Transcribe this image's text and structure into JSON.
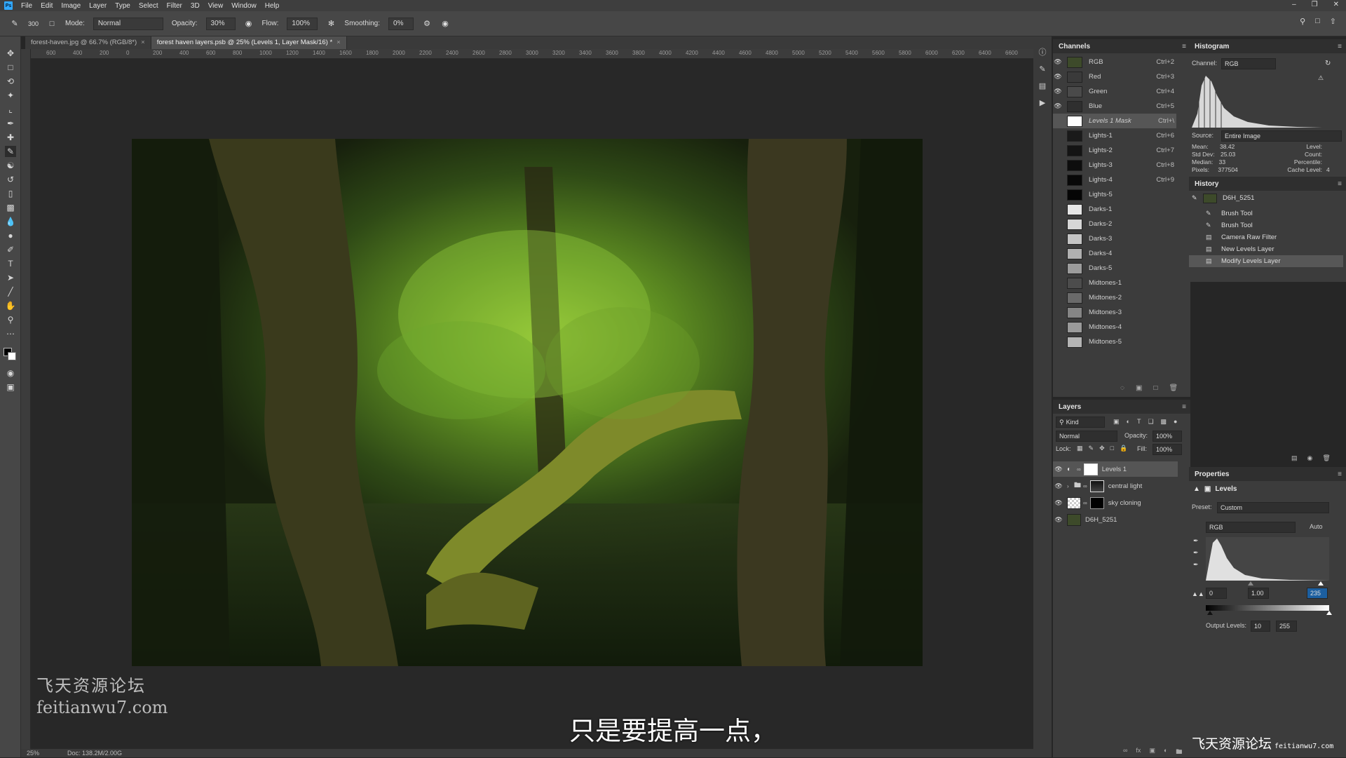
{
  "menubar": {
    "logo": "Ps",
    "items": [
      "File",
      "Edit",
      "Image",
      "Layer",
      "Type",
      "Select",
      "Filter",
      "3D",
      "View",
      "Window",
      "Help"
    ]
  },
  "options": {
    "brush_size": "300",
    "mode_label": "Mode:",
    "mode_value": "Normal",
    "opacity_label": "Opacity:",
    "opacity_value": "30%",
    "flow_label": "Flow:",
    "flow_value": "100%",
    "smoothing_label": "Smoothing:",
    "smoothing_value": "0%"
  },
  "tabs": [
    {
      "label": "forest-haven.jpg @ 66.7% (RGB/8*)"
    },
    {
      "label": "forest haven layers.psb @ 25% (Levels 1, Layer Mask/16) *"
    }
  ],
  "ruler_top": [
    "600",
    "400",
    "200",
    "0",
    "200",
    "400",
    "600",
    "800",
    "1000",
    "1200",
    "1400",
    "1600",
    "1800",
    "2000",
    "2200",
    "2400",
    "2600",
    "2800",
    "3000",
    "3200",
    "3400",
    "3600",
    "3800",
    "4000",
    "4200",
    "4400",
    "4600",
    "4800",
    "5000",
    "5200",
    "5400",
    "5600",
    "5800",
    "6000",
    "6200",
    "6400",
    "6600"
  ],
  "channels": {
    "title": "Channels",
    "rows": [
      {
        "name": "RGB",
        "shortcut": "Ctrl+2",
        "thumb": "#3d4a2a",
        "eye": true
      },
      {
        "name": "Red",
        "shortcut": "Ctrl+3",
        "thumb": "#3a3a3a",
        "eye": true
      },
      {
        "name": "Green",
        "shortcut": "Ctrl+4",
        "thumb": "#4a4a4a",
        "eye": true
      },
      {
        "name": "Blue",
        "shortcut": "Ctrl+5",
        "thumb": "#2f2f2f",
        "eye": true
      },
      {
        "name": "Levels 1 Mask",
        "shortcut": "Ctrl+\\",
        "thumb": "#ffffff",
        "eye": false,
        "selected": true
      },
      {
        "name": "Lights-1",
        "shortcut": "Ctrl+6",
        "thumb": "#1a1a1a",
        "eye": false
      },
      {
        "name": "Lights-2",
        "shortcut": "Ctrl+7",
        "thumb": "#141414",
        "eye": false
      },
      {
        "name": "Lights-3",
        "shortcut": "Ctrl+8",
        "thumb": "#0d0d0d",
        "eye": false
      },
      {
        "name": "Lights-4",
        "shortcut": "Ctrl+9",
        "thumb": "#080808",
        "eye": false
      },
      {
        "name": "Lights-5",
        "shortcut": "",
        "thumb": "#050505",
        "eye": false
      },
      {
        "name": "Darks-1",
        "shortcut": "",
        "thumb": "#e6e6e6",
        "eye": false
      },
      {
        "name": "Darks-2",
        "shortcut": "",
        "thumb": "#d6d6d6",
        "eye": false
      },
      {
        "name": "Darks-3",
        "shortcut": "",
        "thumb": "#c4c4c4",
        "eye": false
      },
      {
        "name": "Darks-4",
        "shortcut": "",
        "thumb": "#b0b0b0",
        "eye": false
      },
      {
        "name": "Darks-5",
        "shortcut": "",
        "thumb": "#9c9c9c",
        "eye": false
      },
      {
        "name": "Midtones-1",
        "shortcut": "",
        "thumb": "#4c4c4c",
        "eye": false
      },
      {
        "name": "Midtones-2",
        "shortcut": "",
        "thumb": "#6a6a6a",
        "eye": false
      },
      {
        "name": "Midtones-3",
        "shortcut": "",
        "thumb": "#858585",
        "eye": false
      },
      {
        "name": "Midtones-4",
        "shortcut": "",
        "thumb": "#9a9a9a",
        "eye": false
      },
      {
        "name": "Midtones-5",
        "shortcut": "",
        "thumb": "#b4b4b4",
        "eye": false
      }
    ]
  },
  "histogram": {
    "title": "Histogram",
    "channel_label": "Channel:",
    "channel_value": "RGB",
    "source_label": "Source:",
    "source_value": "Entire Image",
    "stats": [
      {
        "k": "Mean:",
        "v": "38.42"
      },
      {
        "k": "Std Dev:",
        "v": "25.03"
      },
      {
        "k": "Median:",
        "v": "33"
      },
      {
        "k": "Pixels:",
        "v": "377504"
      }
    ],
    "stats_right": [
      {
        "k": "Level:",
        "v": ""
      },
      {
        "k": "Count:",
        "v": ""
      },
      {
        "k": "Percentile:",
        "v": ""
      },
      {
        "k": "Cache Level:",
        "v": "4"
      }
    ]
  },
  "history": {
    "title": "History",
    "snapshot": "D6H_5251",
    "items": [
      {
        "label": "Brush Tool",
        "icon": "brush-icon"
      },
      {
        "label": "Brush Tool",
        "icon": "brush-icon"
      },
      {
        "label": "Camera Raw Filter",
        "icon": "document-icon"
      },
      {
        "label": "New Levels Layer",
        "icon": "document-icon"
      },
      {
        "label": "Modify Levels Layer",
        "icon": "document-icon",
        "selected": true
      }
    ]
  },
  "layers": {
    "title": "Layers",
    "kind_label": "Kind",
    "blend_mode": "Normal",
    "opacity_label": "Opacity:",
    "opacity_value": "100%",
    "lock_label": "Lock:",
    "fill_label": "Fill:",
    "fill_value": "100%",
    "rows": [
      {
        "name": "Levels 1",
        "selected": true
      },
      {
        "name": "central light"
      },
      {
        "name": "sky cloning"
      },
      {
        "name": "D6H_5251"
      }
    ]
  },
  "properties": {
    "title": "Properties",
    "adjustment": "Levels",
    "preset_label": "Preset:",
    "preset_value": "Custom",
    "channel_value": "RGB",
    "auto_label": "Auto",
    "input_black": "0",
    "input_gamma": "1.00",
    "input_white": "235",
    "output_label": "Output Levels:",
    "output_black": "10",
    "output_white": "255"
  },
  "status": {
    "zoom": "25%",
    "doc": "Doc: 138.2M/2.00G"
  },
  "watermark": {
    "line1": "飞天资源论坛",
    "line2": "feitianwu7.com"
  },
  "subtitle": "只是要提高一点，",
  "corner_logo": {
    "text": "飞天资源论坛",
    "site": "feitianwu7.com"
  },
  "colors": {
    "accent": "#31a8ff",
    "panel_bg": "#3c3c3c",
    "selected_row": "#565656"
  }
}
